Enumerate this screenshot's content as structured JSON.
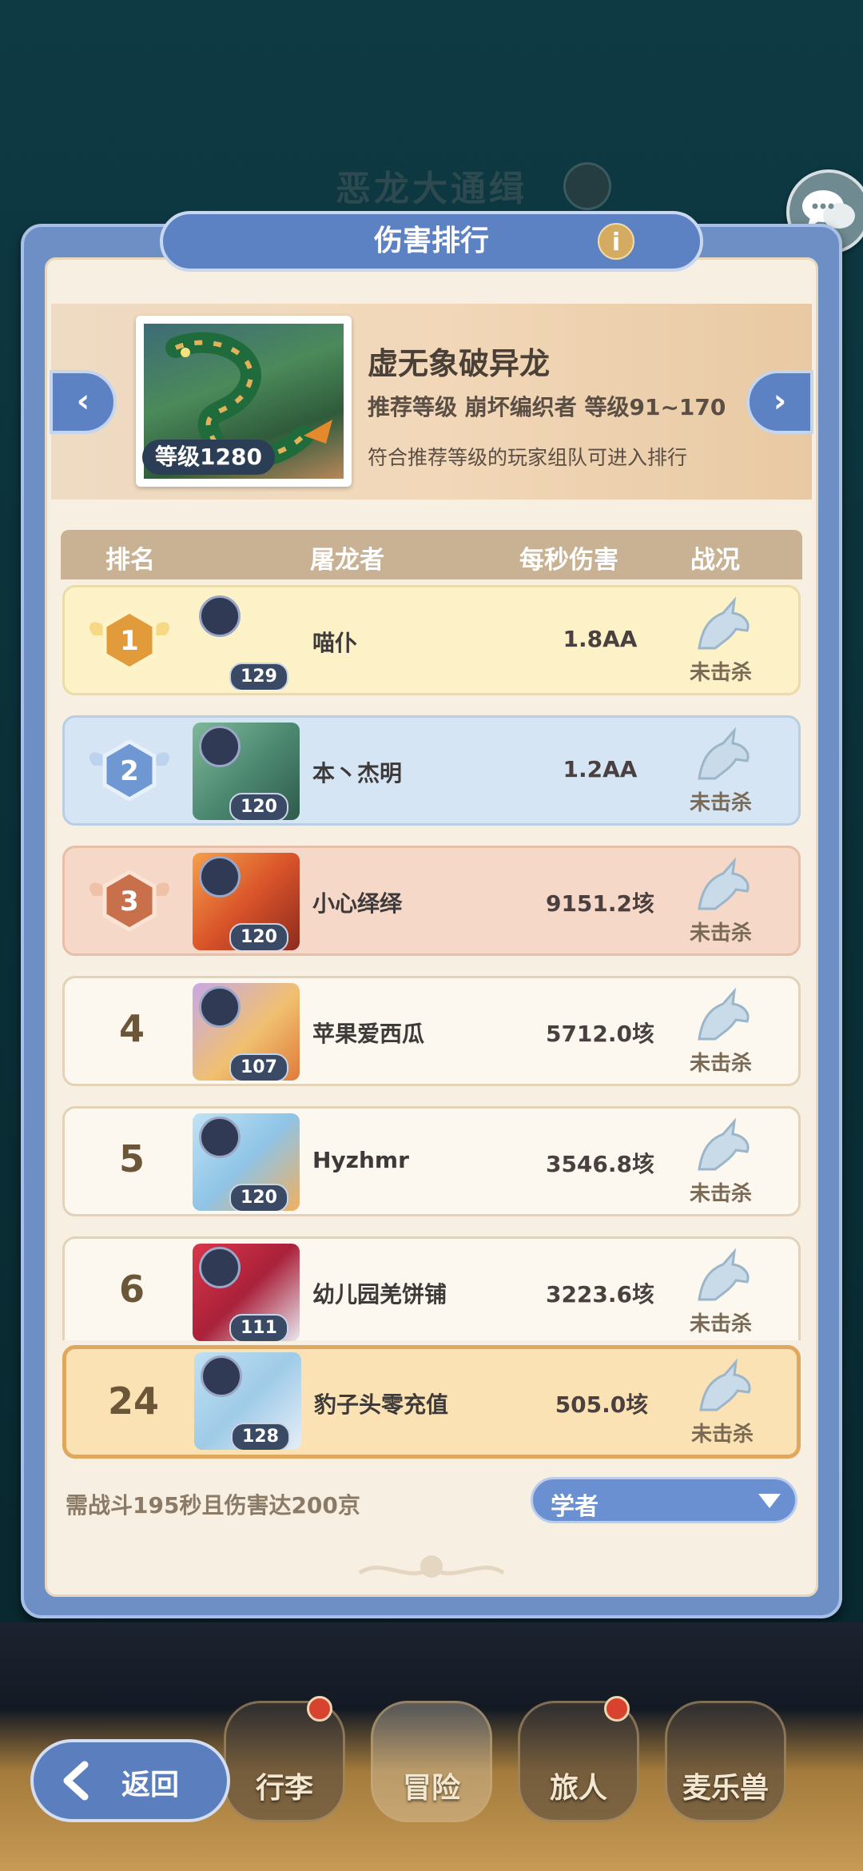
{
  "background": {
    "event_title": "恶龙大通缉"
  },
  "panel": {
    "title": "伤害排行",
    "info_icon": "i"
  },
  "boss": {
    "name": "虚无象破异龙",
    "level": "等级1280",
    "recommended": "推荐等级 崩坏编织者  等级91~170",
    "note": "符合推荐等级的玩家组队可进入排行"
  },
  "table": {
    "headers": {
      "rank": "排名",
      "player": "屠龙者",
      "dps": "每秒伤害",
      "status": "战况"
    },
    "rows": [
      {
        "rank": "1",
        "avatar_level": "129",
        "name": "喵仆",
        "dps": "1.8AA",
        "status": "未击杀"
      },
      {
        "rank": "2",
        "avatar_level": "120",
        "name": "本丶杰明",
        "dps": "1.2AA",
        "status": "未击杀"
      },
      {
        "rank": "3",
        "avatar_level": "120",
        "name": "小心绎绎",
        "dps": "9151.2垓",
        "status": "未击杀"
      },
      {
        "rank": "4",
        "avatar_level": "107",
        "name": "苹果爱西瓜",
        "dps": "5712.0垓",
        "status": "未击杀"
      },
      {
        "rank": "5",
        "avatar_level": "120",
        "name": "Hyzhmr",
        "dps": "3546.8垓",
        "status": "未击杀"
      },
      {
        "rank": "6",
        "avatar_level": "111",
        "name": "幼儿园羌饼铺",
        "dps": "3223.6垓",
        "status": "未击杀"
      }
    ],
    "self_row": {
      "rank": "24",
      "avatar_level": "128",
      "name": "豹子头零充值",
      "dps": "505.0垓",
      "status": "未击杀"
    }
  },
  "footer": {
    "requirement": "需战斗195秒且伤害达200京",
    "class_select": "学者"
  },
  "nav": {
    "back": "返回",
    "items": [
      "行李",
      "冒险",
      "旅人",
      "麦乐兽"
    ]
  },
  "colors": {
    "panel_blue": "#6d8fc6",
    "parchment": "#f6efe2",
    "gold_row": "#fdf1c8",
    "silver_row": "#d6e5f4",
    "bronze_row": "#f6d8c8",
    "self_row": "#fbe2b4"
  }
}
